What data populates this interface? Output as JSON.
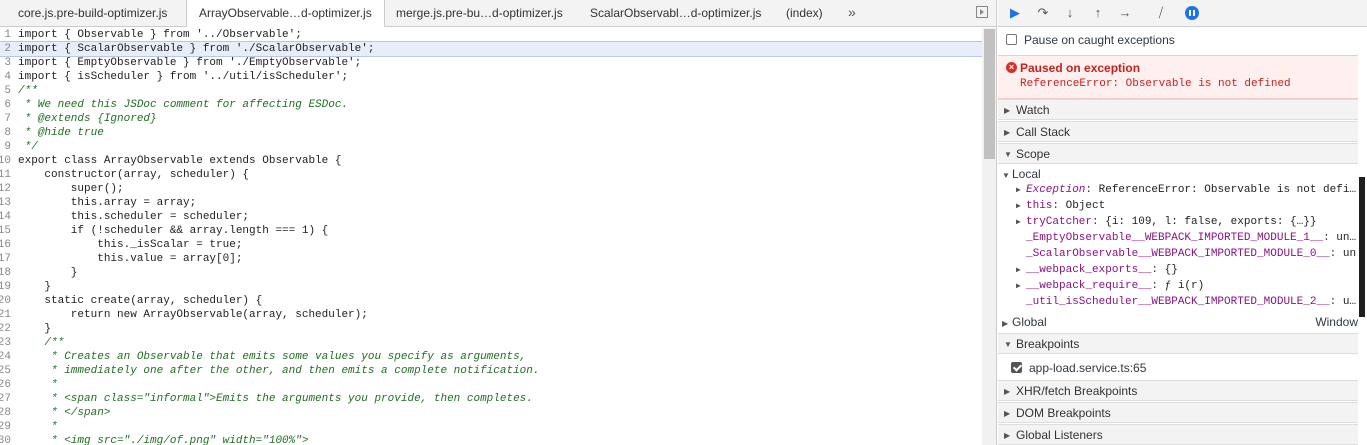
{
  "tabs": [
    {
      "label": "core.js.pre-build-optimizer.js",
      "active": false
    },
    {
      "label": "ArrayObservable…d-optimizer.js",
      "active": true
    },
    {
      "label": "merge.js.pre-bu…d-optimizer.js",
      "active": false
    },
    {
      "label": "ScalarObservabl…d-optimizer.js",
      "active": false
    },
    {
      "label": "(index)",
      "active": false
    }
  ],
  "tab_overflow": "»",
  "code_lines": [
    {
      "n": "1",
      "t": "import { Observable } from '../Observable';"
    },
    {
      "n": "2",
      "t": "import { ScalarObservable } from './ScalarObservable';"
    },
    {
      "n": "3",
      "t": "import { EmptyObservable } from './EmptyObservable';"
    },
    {
      "n": "4",
      "t": "import { isScheduler } from '../util/isScheduler';"
    },
    {
      "n": "5",
      "t": "/**"
    },
    {
      "n": "6",
      "t": " * We need this JSDoc comment for affecting ESDoc."
    },
    {
      "n": "7",
      "t": " * @extends {Ignored}"
    },
    {
      "n": "8",
      "t": " * @hide true"
    },
    {
      "n": "9",
      "t": " */"
    },
    {
      "n": "10",
      "t": "export class ArrayObservable extends Observable {"
    },
    {
      "n": "11",
      "t": "    constructor(array, scheduler) {"
    },
    {
      "n": "12",
      "t": "        super();"
    },
    {
      "n": "13",
      "t": "        this.array = array;"
    },
    {
      "n": "14",
      "t": "        this.scheduler = scheduler;"
    },
    {
      "n": "15",
      "t": "        if (!scheduler && array.length === 1) {"
    },
    {
      "n": "16",
      "t": "            this._isScalar = true;"
    },
    {
      "n": "17",
      "t": "            this.value = array[0];"
    },
    {
      "n": "18",
      "t": "        }"
    },
    {
      "n": "19",
      "t": "    }"
    },
    {
      "n": "20",
      "t": "    static create(array, scheduler) {"
    },
    {
      "n": "21",
      "t": "        return new ArrayObservable(array, scheduler);"
    },
    {
      "n": "22",
      "t": "    }"
    },
    {
      "n": "23",
      "t": "    /**"
    },
    {
      "n": "24",
      "t": "     * Creates an Observable that emits some values you specify as arguments,"
    },
    {
      "n": "25",
      "t": "     * immediately one after the other, and then emits a complete notification."
    },
    {
      "n": "26",
      "t": "     *"
    },
    {
      "n": "27",
      "t": "     * <span class=\"informal\">Emits the arguments you provide, then completes."
    },
    {
      "n": "28",
      "t": "     * </span>"
    },
    {
      "n": "29",
      "t": "     *"
    },
    {
      "n": "30",
      "t": "     * <img src=\"./img/of.png\" width=\"100%\">"
    }
  ],
  "highlighted_line": 2,
  "debugger": {
    "pause_on_caught_label": "Pause on caught exceptions",
    "paused_title": "Paused on exception",
    "paused_message": "ReferenceError: Observable is not defined",
    "sections": {
      "watch": "Watch",
      "call_stack": "Call Stack",
      "scope": "Scope",
      "breakpoints": "Breakpoints",
      "xhr": "XHR/fetch Breakpoints",
      "dom": "DOM Breakpoints",
      "global_listeners": "Global Listeners"
    },
    "scope_local_label": "Local",
    "scope_items": [
      {
        "name": "Exception",
        "value": "ReferenceError: Observable is not defi…",
        "expandable": true,
        "italic": true
      },
      {
        "name": "this",
        "value": "Object",
        "expandable": true,
        "italic": false
      },
      {
        "name": "tryCatcher",
        "value": "{i: 109, l: false, exports: {…}}",
        "expandable": true,
        "italic": false
      },
      {
        "name": "_EmptyObservable__WEBPACK_IMPORTED_MODULE_1__",
        "value": "un…",
        "expandable": false,
        "italic": false
      },
      {
        "name": "_ScalarObservable__WEBPACK_IMPORTED_MODULE_0__",
        "value": "un…",
        "expandable": false,
        "italic": false
      },
      {
        "name": "__webpack_exports__",
        "value": "{}",
        "expandable": true,
        "italic": false
      },
      {
        "name": "__webpack_require__",
        "value": "ƒ i(r)",
        "expandable": true,
        "italic": false
      },
      {
        "name": "_util_isScheduler__WEBPACK_IMPORTED_MODULE_2__",
        "value": "u…",
        "expandable": false,
        "italic": false
      }
    ],
    "scope_global_label": "Global",
    "scope_global_value": "Window",
    "breakpoint_item": "app-load.service.ts:65"
  },
  "colors": {
    "accent": "#1a73e8",
    "error": "#c5221f"
  }
}
